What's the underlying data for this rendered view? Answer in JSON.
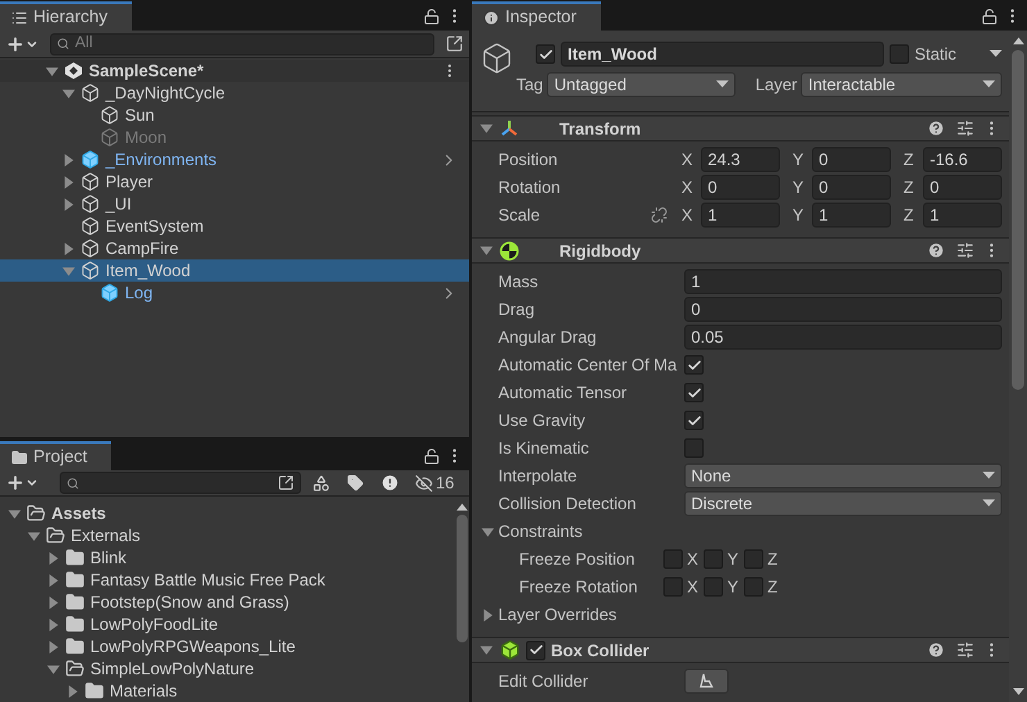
{
  "hierarchy": {
    "tab": "Hierarchy",
    "search_placeholder": "All",
    "scene": {
      "name": "SampleScene*",
      "expanded": true,
      "items": [
        {
          "name": "_DayNightCycle",
          "kind": "object",
          "active": true,
          "selected": false,
          "expanded": true,
          "children": [
            {
              "name": "Sun",
              "kind": "object",
              "active": true,
              "selected": false
            },
            {
              "name": "Moon",
              "kind": "object",
              "active": false,
              "selected": false
            }
          ]
        },
        {
          "name": "_Environments",
          "kind": "prefab",
          "active": true,
          "selected": false,
          "expanded": false
        },
        {
          "name": "Player",
          "kind": "object",
          "active": true,
          "selected": false,
          "expanded": false
        },
        {
          "name": "_UI",
          "kind": "object",
          "active": true,
          "selected": false,
          "expanded": false
        },
        {
          "name": "EventSystem",
          "kind": "object",
          "active": true,
          "selected": false
        },
        {
          "name": "CampFire",
          "kind": "object",
          "active": true,
          "selected": false,
          "expanded": false
        },
        {
          "name": "Item_Wood",
          "kind": "object",
          "active": true,
          "selected": true,
          "expanded": true,
          "children": [
            {
              "name": "Log",
              "kind": "prefab",
              "active": true,
              "selected": false
            }
          ]
        }
      ]
    }
  },
  "project": {
    "tab": "Project",
    "hidden_count": "16",
    "items": [
      {
        "name": "Assets",
        "expanded": true,
        "children": [
          {
            "name": "Externals",
            "expanded": true,
            "children": [
              {
                "name": "Blink",
                "expanded": false
              },
              {
                "name": "Fantasy Battle Music Free Pack",
                "expanded": false
              },
              {
                "name": "Footstep(Snow and Grass)",
                "expanded": false
              },
              {
                "name": "LowPolyFoodLite",
                "expanded": false
              },
              {
                "name": "LowPolyRPGWeapons_Lite",
                "expanded": false
              },
              {
                "name": "SimpleLowPolyNature",
                "expanded": true,
                "children": [
                  {
                    "name": "Materials",
                    "expanded": false
                  }
                ]
              }
            ]
          }
        ]
      }
    ]
  },
  "inspector": {
    "tab": "Inspector",
    "object": {
      "active": true,
      "name": "Item_Wood",
      "static": false,
      "static_label": "Static",
      "tag_label": "Tag",
      "tag": "Untagged",
      "layer_label": "Layer",
      "layer": "Interactable"
    },
    "components": [
      {
        "name": "Transform",
        "expanded": true,
        "fields": [
          {
            "kind": "vector3",
            "label": "Position",
            "values": [
              {
                "axis": "X",
                "value": "24.3"
              },
              {
                "axis": "Y",
                "value": "0"
              },
              {
                "axis": "Z",
                "value": "-16.6"
              }
            ]
          },
          {
            "kind": "vector3",
            "label": "Rotation",
            "values": [
              {
                "axis": "X",
                "value": "0"
              },
              {
                "axis": "Y",
                "value": "0"
              },
              {
                "axis": "Z",
                "value": "0"
              }
            ]
          },
          {
            "kind": "vector3",
            "label": "Scale",
            "linked": false,
            "values": [
              {
                "axis": "X",
                "value": "1"
              },
              {
                "axis": "Y",
                "value": "1"
              },
              {
                "axis": "Z",
                "value": "1"
              }
            ]
          }
        ]
      },
      {
        "name": "Rigidbody",
        "expanded": true,
        "fields": [
          {
            "kind": "number",
            "label": "Mass",
            "value": "1"
          },
          {
            "kind": "number",
            "label": "Drag",
            "value": "0"
          },
          {
            "kind": "number",
            "label": "Angular Drag",
            "value": "0.05"
          },
          {
            "kind": "checkbox",
            "label": "Automatic Center Of Ma",
            "checked": true
          },
          {
            "kind": "checkbox",
            "label": "Automatic Tensor",
            "checked": true
          },
          {
            "kind": "checkbox",
            "label": "Use Gravity",
            "checked": true
          },
          {
            "kind": "checkbox",
            "label": "Is Kinematic",
            "checked": false
          },
          {
            "kind": "dropdown",
            "label": "Interpolate",
            "value": "None"
          },
          {
            "kind": "dropdown",
            "label": "Collision Detection",
            "value": "Discrete"
          },
          {
            "kind": "foldout",
            "label": "Constraints",
            "expanded": true,
            "children": [
              {
                "kind": "toggles",
                "label": "Freeze Position",
                "toggles": [
                  {
                    "axis": "X",
                    "checked": false
                  },
                  {
                    "axis": "Y",
                    "checked": false
                  },
                  {
                    "axis": "Z",
                    "checked": false
                  }
                ]
              },
              {
                "kind": "toggles",
                "label": "Freeze Rotation",
                "toggles": [
                  {
                    "axis": "X",
                    "checked": false
                  },
                  {
                    "axis": "Y",
                    "checked": false
                  },
                  {
                    "axis": "Z",
                    "checked": false
                  }
                ]
              }
            ]
          },
          {
            "kind": "foldout",
            "label": "Layer Overrides",
            "expanded": false
          }
        ]
      },
      {
        "name": "Box Collider",
        "enabled": true,
        "expanded": true,
        "fields": [
          {
            "kind": "button",
            "label": "Edit Collider"
          }
        ]
      }
    ]
  }
}
